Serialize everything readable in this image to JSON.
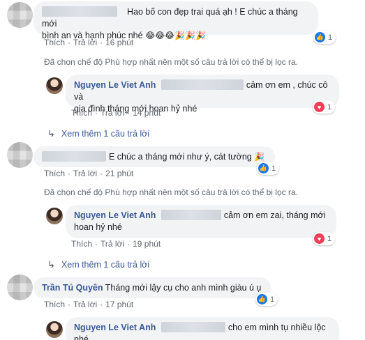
{
  "comments": [
    {
      "text_line1": "Hao bố con đẹp trai quá ạh ! E chúc a tháng mới",
      "text_line2": "bình an và hạnh phúc nhé",
      "emojis": "😂😂😂🎉🎉🎉",
      "reaction_count": "1",
      "reaction_type": "like",
      "actions": {
        "like": "Thích",
        "reply": "Trả lời",
        "time": "16 phút"
      },
      "notice": "Đã chọn chế độ Phù hợp nhất nên một số câu trả lời có thể bị lọc ra.",
      "reply": {
        "name": "Nguyen Le Viet Anh",
        "text_line1": "cảm ơn em , chúc cô và",
        "text_line2": "gia đình tháng mới hoan hỷ nhé",
        "reaction_count": "1",
        "reaction_type": "love",
        "actions": {
          "like": "Thích",
          "reply": "Trả lời",
          "time": "14 phút"
        }
      },
      "see_more": "Xem thêm 1 câu trả lời"
    },
    {
      "text_line1": "E chúc a tháng mới như ý, cát tường",
      "emojis": "🎉",
      "reaction_count": "1",
      "reaction_type": "like",
      "actions": {
        "like": "Thích",
        "reply": "Trả lời",
        "time": "21 phút"
      },
      "notice": "Đã chọn chế độ Phù hợp nhất nên một số câu trả lời có thể bị lọc ra.",
      "reply": {
        "name": "Nguyen Le Viet Anh",
        "text_line1": "cảm ơn em zai, tháng mới",
        "text_line2": "hoan hỷ nhé",
        "reaction_count": "1",
        "reaction_type": "love",
        "actions": {
          "like": "Thích",
          "reply": "Trả lời",
          "time": "19 phút"
        }
      },
      "see_more": "Xem thêm 1 câu trả lời"
    },
    {
      "name": "Trần Tú Quyên",
      "text_line1": "Tháng mới lậy cụ cho anh mình giàu ú ụ",
      "reaction_count": "1",
      "reaction_type": "like",
      "actions": {
        "like": "Thích",
        "reply": "Trả lời",
        "time": "17 phút"
      },
      "reply": {
        "name": "Nguyen Le Viet Anh",
        "text_line1": "cho em mình tụ nhiều lộc",
        "text_line2": "nhé"
      }
    }
  ],
  "colors": {
    "name": "#385898",
    "bubble": "#f2f3f5",
    "like": "#1877f2",
    "love": "#f33e58",
    "meta": "#606770"
  }
}
